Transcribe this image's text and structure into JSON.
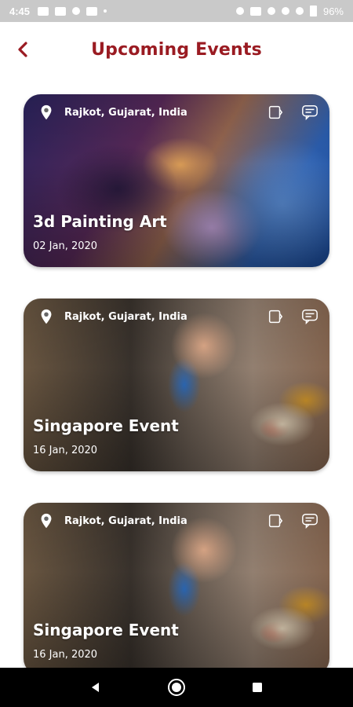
{
  "status_bar": {
    "time": "4:45",
    "battery": "96%"
  },
  "header": {
    "title": "Upcoming Events"
  },
  "events": [
    {
      "location": "Rajkot, Gujarat, India",
      "name": "3d Painting Art",
      "date": "02 Jan, 2020"
    },
    {
      "location": "Rajkot, Gujarat, India",
      "name": "Singapore Event",
      "date": "16 Jan, 2020"
    },
    {
      "location": "Rajkot, Gujarat, India",
      "name": "Singapore Event",
      "date": "16 Jan, 2020"
    }
  ],
  "colors": {
    "accent": "#9a1b22",
    "statusbar": "#c9c9c9",
    "navbar": "#000000"
  },
  "icons": [
    "back-arrow-icon",
    "location-pin-icon",
    "ticket-icon",
    "chat-icon",
    "nav-back-icon",
    "nav-home-icon",
    "nav-recents-icon"
  ]
}
